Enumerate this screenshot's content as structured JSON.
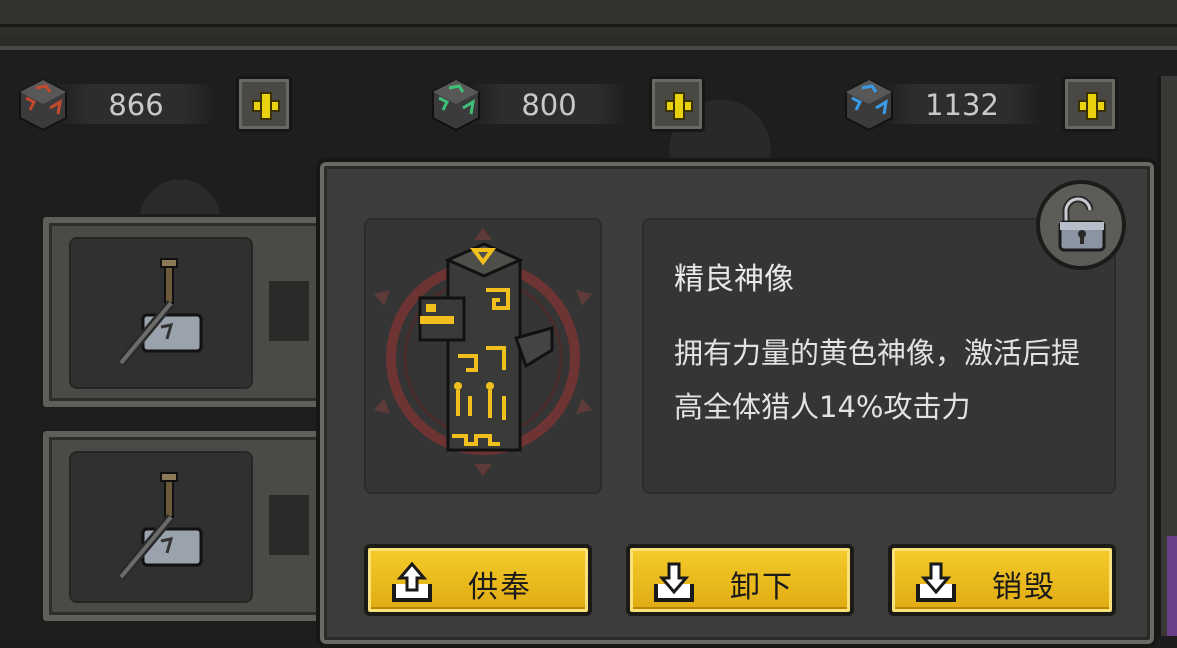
{
  "resources": [
    {
      "icon": "red-rune-cube-icon",
      "value": "866",
      "color": "#c24a2e"
    },
    {
      "icon": "green-rune-cube-icon",
      "value": "800",
      "color": "#3fbf78"
    },
    {
      "icon": "blue-rune-cube-icon",
      "value": "1132",
      "color": "#3a9be6"
    }
  ],
  "item": {
    "name": "精良神像",
    "description": "拥有力量的黄色神像，激活后提高全体猎人14%攻击力",
    "icon": "yellow-totem-statue-icon"
  },
  "actions": [
    {
      "label": "供奉",
      "icon": "upload-tray-icon"
    },
    {
      "label": "卸下",
      "icon": "download-tray-icon"
    },
    {
      "label": "销毁",
      "icon": "download-tray-icon"
    }
  ],
  "left_slots": [
    {
      "icon": "hammer-icon"
    },
    {
      "icon": "hammer-icon"
    }
  ],
  "colors": {
    "button_yellow": "#f0c020",
    "plus_yellow": "#e8d10e",
    "panel_bg": "#3c3c3a"
  }
}
